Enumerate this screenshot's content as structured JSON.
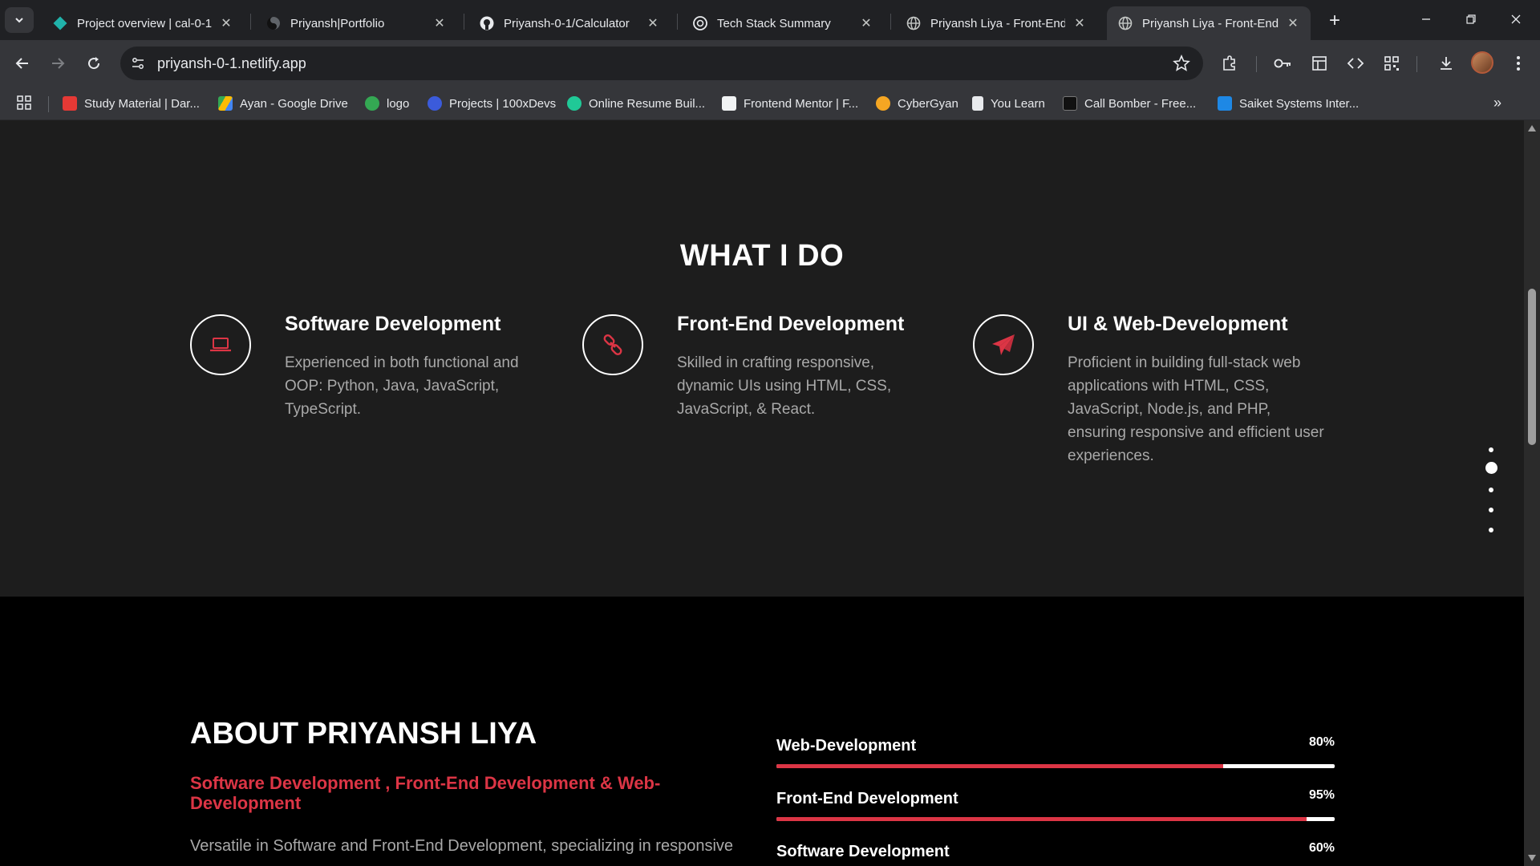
{
  "browser": {
    "tabs": [
      {
        "title": "Project overview | cal-0-1 |",
        "favicon": "netlify-diamond-icon",
        "active": false
      },
      {
        "title": "Priyansh|Portfolio",
        "favicon": "portfolio-icon",
        "active": false
      },
      {
        "title": "Priyansh-0-1/Calculator",
        "favicon": "github-icon",
        "active": false
      },
      {
        "title": "Tech Stack Summary",
        "favicon": "chatgpt-icon",
        "active": false
      },
      {
        "title": "Priyansh Liya - Front-End &",
        "favicon": "globe-icon",
        "active": false
      },
      {
        "title": "Priyansh Liya - Front-End &",
        "favicon": "globe-icon",
        "active": true
      }
    ],
    "url": "priyansh-0-1.netlify.app",
    "bookmarks": [
      {
        "label": "Study Material | Dar...",
        "color": "#e53935"
      },
      {
        "label": "Ayan - Google Drive",
        "color": "#fbbc04"
      },
      {
        "label": "logo",
        "color": "#34a853"
      },
      {
        "label": "Projects | 100xDevs",
        "color": "#3b5bdb"
      },
      {
        "label": "Online Resume Buil...",
        "color": "#20c997"
      },
      {
        "label": "Frontend Mentor | F...",
        "color": "#f1f3f4"
      },
      {
        "label": "CyberGyan",
        "color": "#f5a623"
      },
      {
        "label": "You Learn",
        "color": "#e8eaed"
      },
      {
        "label": "Call Bomber - Free...",
        "color": "#111111"
      },
      {
        "label": "Saiket Systems Inter...",
        "color": "#1e88e5"
      }
    ]
  },
  "what_i_do": {
    "heading": "WHAT I DO",
    "services": [
      {
        "title": "Software Development",
        "icon": "laptop-icon",
        "description": "Experienced in both functional and OOP: Python, Java, JavaScript, TypeScript."
      },
      {
        "title": "Front-End Development",
        "icon": "link-icon",
        "description": "Skilled in crafting responsive, dynamic UIs using HTML, CSS, JavaScript, & React."
      },
      {
        "title": "UI & Web-Development",
        "icon": "paper-plane-icon",
        "description": "Proficient in building full-stack web applications with HTML, CSS, JavaScript, Node.js, and PHP, ensuring responsive and efficient user experiences."
      }
    ]
  },
  "section_nav": {
    "count": 5,
    "active_index": 1
  },
  "about": {
    "heading": "ABOUT PRIYANSH LIYA",
    "subtitle": "Software Development , Front-End Development & Web-Development",
    "description": "Versatile in Software and Front-End Development, specializing in responsive",
    "skills": [
      {
        "name": "Web-Development",
        "percent_label": "80%",
        "value": 80
      },
      {
        "name": "Front-End Development",
        "percent_label": "95%",
        "value": 95
      },
      {
        "name": "Software Development",
        "percent_label": "60%",
        "value": 60
      }
    ]
  },
  "colors": {
    "accent": "#dc3545",
    "section_dark": "#1d1d1d",
    "section_black": "#000000"
  }
}
